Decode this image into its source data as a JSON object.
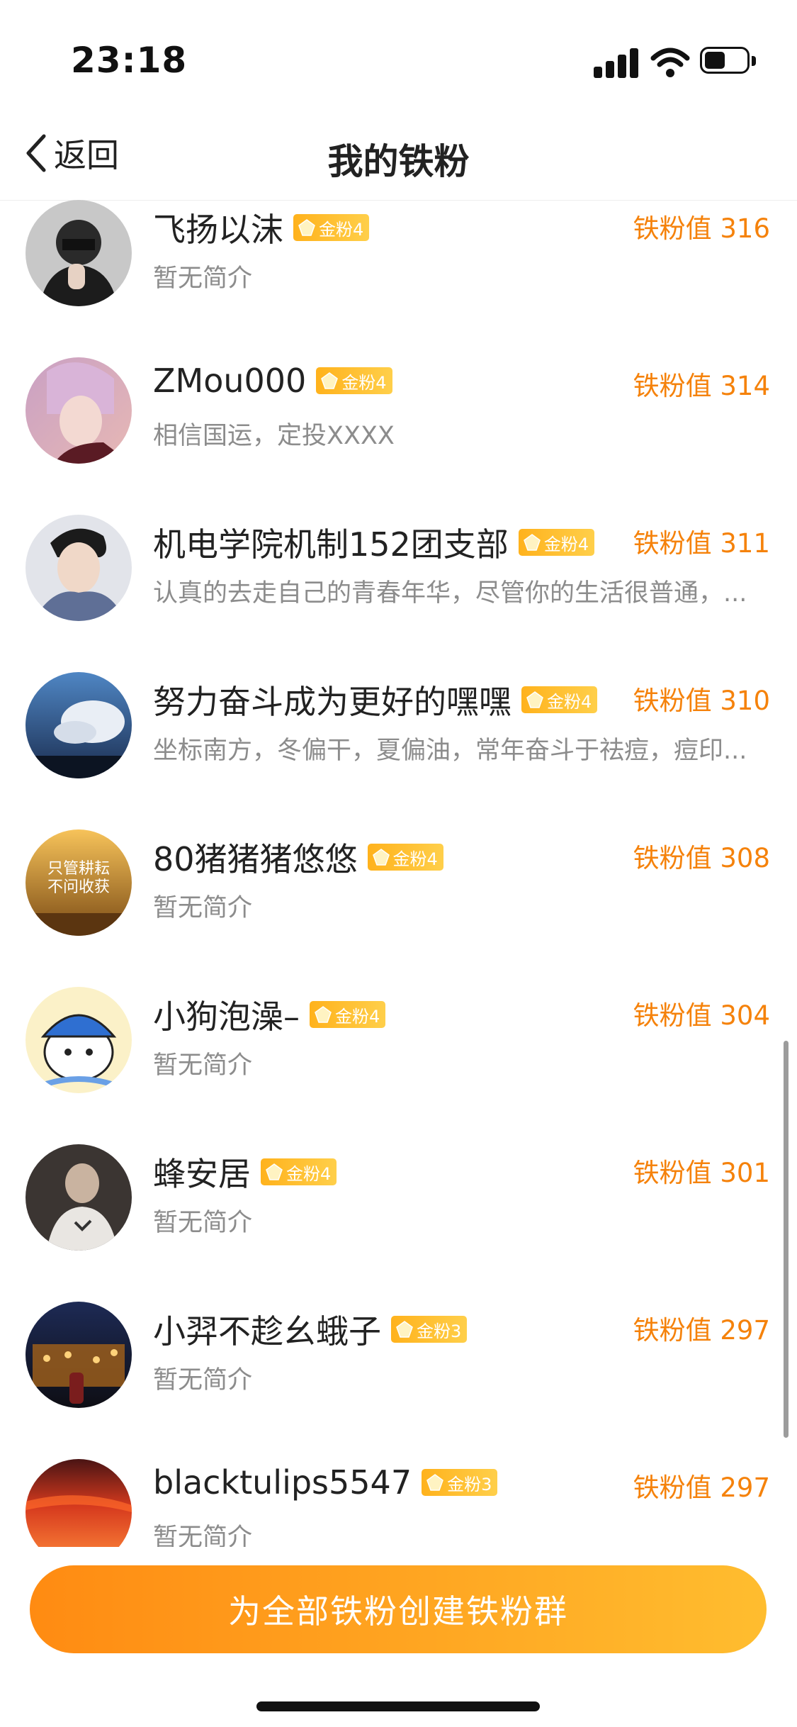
{
  "status_bar": {
    "time": "23:18"
  },
  "nav": {
    "back_label": "返回",
    "title": "我的铁粉"
  },
  "fans": [
    {
      "name": "飞扬以沫",
      "badge": "金粉4",
      "bio": "暂无简介",
      "score": "铁粉值 316"
    },
    {
      "name": "ZMou000",
      "badge": "金粉4",
      "bio": "相信国运，定投XXXX",
      "score": "铁粉值 314"
    },
    {
      "name": "机电学院机制152团支部",
      "badge": "金粉4",
      "bio": "认真的去走自己的青春年华，尽管你的生活很普通，...",
      "score": "铁粉值 311"
    },
    {
      "name": "努力奋斗成为更好的嘿嘿",
      "badge": "金粉4",
      "bio": "坐标南方，冬偏干，夏偏油，常年奋斗于祛痘，痘印...",
      "score": "铁粉值 310"
    },
    {
      "name": "80猪猪猪悠悠",
      "badge": "金粉4",
      "bio": "暂无简介",
      "score": "铁粉值 308"
    },
    {
      "name": "小狗泡澡–",
      "badge": "金粉4",
      "bio": "暂无简介",
      "score": "铁粉值 304"
    },
    {
      "name": "蜂安居",
      "badge": "金粉4",
      "bio": "暂无简介",
      "score": "铁粉值 301"
    },
    {
      "name": "小羿不趁幺蛾子",
      "badge": "金粉3",
      "bio": "暂无简介",
      "score": "铁粉值 297"
    },
    {
      "name": "blacktulips5547",
      "badge": "金粉3",
      "bio": "暂无简介",
      "score": "铁粉值 297"
    }
  ],
  "avatar_art": {
    "row5_text_1": "只管耕耘",
    "row5_text_2": "不问收获"
  },
  "cta": {
    "label": "为全部铁粉创建铁粉群"
  },
  "colors": {
    "accent_orange": "#f5820b",
    "badge_gold": "#ffb21c",
    "cta_start": "#ff8b12",
    "cta_end": "#ffbd2f"
  }
}
